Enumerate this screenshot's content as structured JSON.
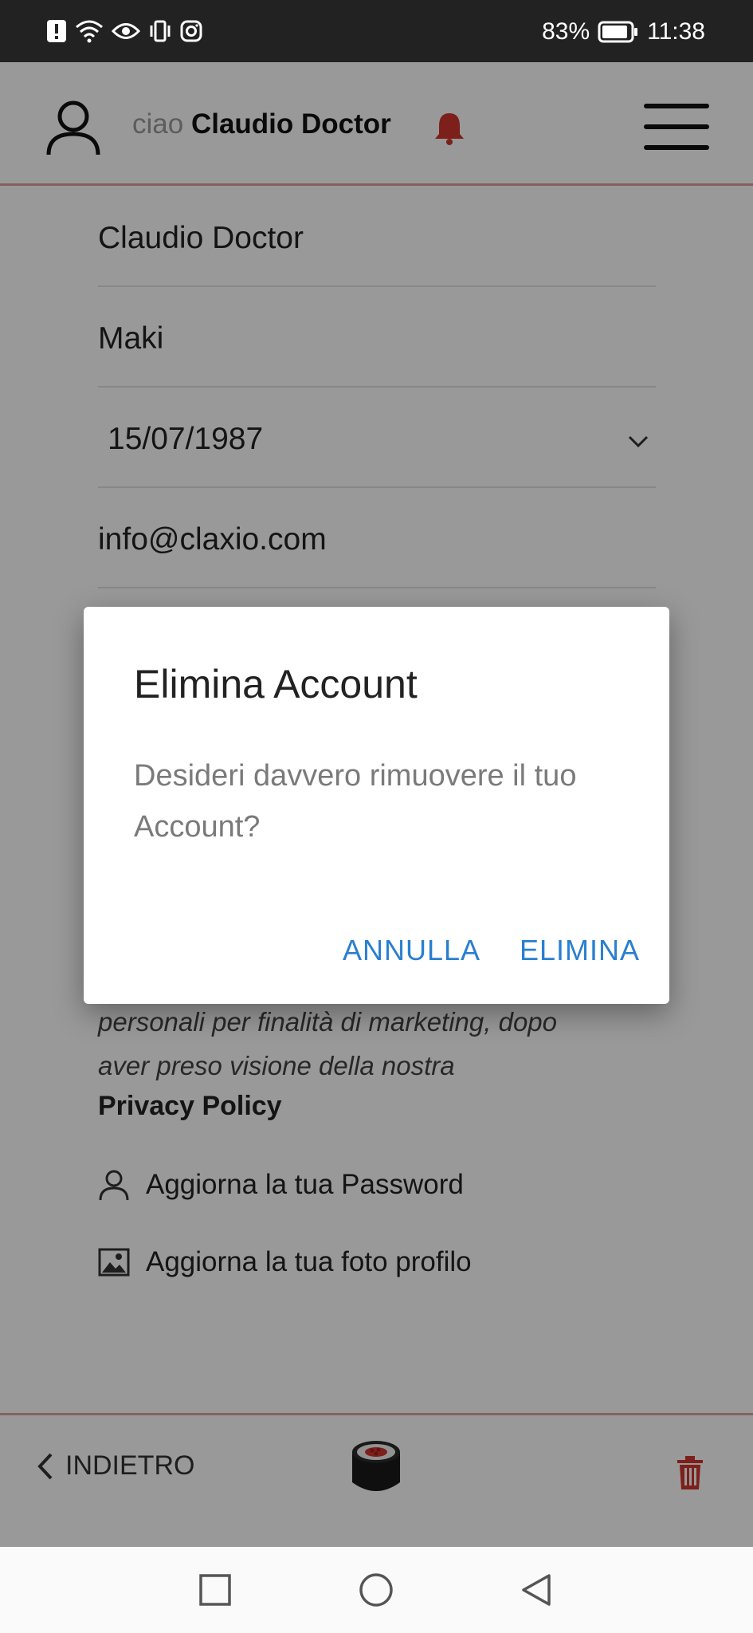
{
  "status_bar": {
    "battery": "83%",
    "time": "11:38",
    "icons": [
      "alert-icon",
      "wifi-icon",
      "eye-icon",
      "vibrate-icon",
      "instagram-icon",
      "battery-icon"
    ]
  },
  "header": {
    "greeting_prefix": "ciao",
    "user_name": "Claudio Doctor"
  },
  "form": {
    "first_name": "Claudio Doctor",
    "last_name": "Maki",
    "birth_date": "15/07/1987",
    "email": "info@claxio.com"
  },
  "consent": {
    "text_line1": "personali per finalità di marketing, dopo",
    "text_line2": "aver preso visione della nostra",
    "privacy_link": "Privacy Policy"
  },
  "actions": {
    "update_password": "Aggiorna la tua Password",
    "update_photo": "Aggiorna la tua foto profilo"
  },
  "footer": {
    "back_label": "INDIETRO"
  },
  "dialog": {
    "title": "Elimina Account",
    "message": "Desideri davvero rimuovere il tuo Account?",
    "cancel_label": "ANNULLA",
    "confirm_label": "ELIMINA"
  },
  "colors": {
    "accent_red": "#d0342c",
    "dialog_button_blue": "#2a7fd0",
    "divider_rose": "#d9a49d"
  }
}
